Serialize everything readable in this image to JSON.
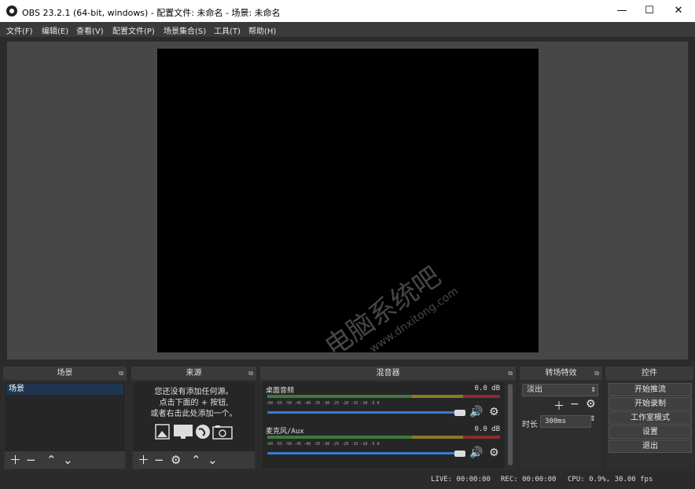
{
  "window": {
    "title": "OBS 23.2.1 (64-bit, windows) - 配置文件: 未命名 - 场景: 未命名",
    "minimize": "—",
    "maximize": "☐",
    "close": "✕"
  },
  "menu": [
    "文件(F)",
    "编辑(E)",
    "查看(V)",
    "配置文件(P)",
    "场景集合(S)",
    "工具(T)",
    "帮助(H)"
  ],
  "docks": {
    "scenes": {
      "title": "场景",
      "items": [
        "场景"
      ]
    },
    "sources": {
      "title": "来源",
      "hint_line1": "您还没有添加任何源。",
      "hint_line2": "点击下面的 + 按钮,",
      "hint_line3": "或者右击此处添加一个。"
    },
    "mixer": {
      "title": "混音器",
      "channels": [
        {
          "name": "桌面音频",
          "level": "0.0 dB",
          "volume": 0.92
        },
        {
          "name": "麦克风/Aux",
          "level": "0.0 dB",
          "volume": 0.92
        }
      ],
      "ticks": "-60  -55  -50  -45  -40  -35  -30  -25  -20  -15  -10  -5  0"
    },
    "transitions": {
      "title": "转场特效",
      "selected": "淡出",
      "duration_label": "时长",
      "duration_value": "300ms"
    },
    "controls": {
      "title": "控件",
      "buttons": [
        "开始推流",
        "开始录制",
        "工作室模式",
        "设置",
        "退出"
      ]
    }
  },
  "status": {
    "live": "LIVE: 00:00:00",
    "rec": "REC: 00:00:00",
    "cpu": "CPU: 0.9%, 30.00 fps"
  },
  "watermark": {
    "text_cn": "电脑系统吧",
    "text_url": "www.dnxitong.com"
  },
  "colors": {
    "accent": "#3b7bd4",
    "scene_selected": "#1f3550",
    "preview_bg": "#000000"
  }
}
